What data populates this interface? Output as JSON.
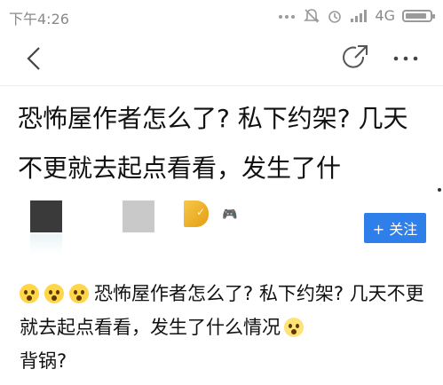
{
  "status_bar": {
    "time": "下午4:26",
    "network": "4G",
    "icons": [
      "dots-icon",
      "mute-icon",
      "alarm-icon",
      "signal-icon",
      "battery-icon"
    ],
    "battery_level": 0.9
  },
  "nav": {
    "icons": [
      "back-arrow-icon",
      "share-icon",
      "more-icon"
    ]
  },
  "article": {
    "title": "恐怖屋作者怎么了? 私下约架? 几天不更就去起点看看，发生了什",
    "follow_button": "+ 关注",
    "body_text": "恐怖屋作者怎么了? 私下约架? 几天不更就去起点看看，发生了什么情况",
    "body_tail": "背锅?"
  },
  "colors": {
    "accent": "#2f7fea",
    "status_text": "#8a8a8a"
  }
}
